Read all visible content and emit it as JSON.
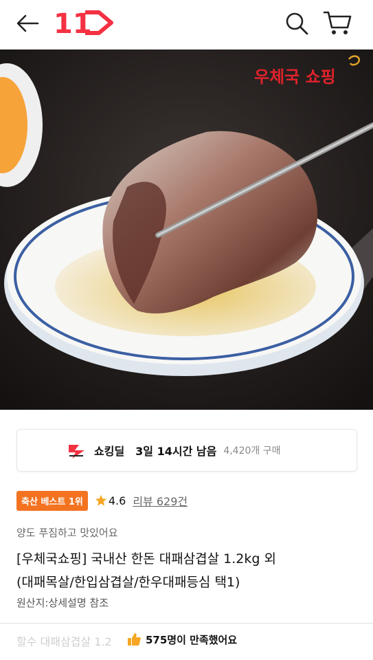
{
  "header": {
    "back_icon": "arrow-left-icon",
    "logo_text": "11",
    "search_icon": "search-icon",
    "cart_icon": "cart-icon"
  },
  "product_image": {
    "overlay_text": "우체국 쇼핑"
  },
  "deal": {
    "title": "쇼킹딜",
    "time_left": "3일 14시간 남음",
    "purchase_count": "4,420개 구매"
  },
  "rating": {
    "badge": "축산 베스트 1위",
    "score": "4.6",
    "reviews": "리뷰 629건"
  },
  "product": {
    "subtitle": "양도 푸짐하고 맛있어요",
    "title_line1": "[우체국쇼핑] 국내산 한돈 대패삼겹살 1.2kg 외",
    "title_line2": "(대패목살/한입삼겹살/한우대패등심 택1)",
    "origin": "원산지:상세설명 참조"
  },
  "bottom": {
    "faded_text": "할수 대패삼겹살 1.2",
    "satisfaction": "575명이 만족했어요"
  },
  "colors": {
    "brand_red": "#f43142",
    "badge_orange": "#f37321",
    "star": "#f5a623"
  }
}
